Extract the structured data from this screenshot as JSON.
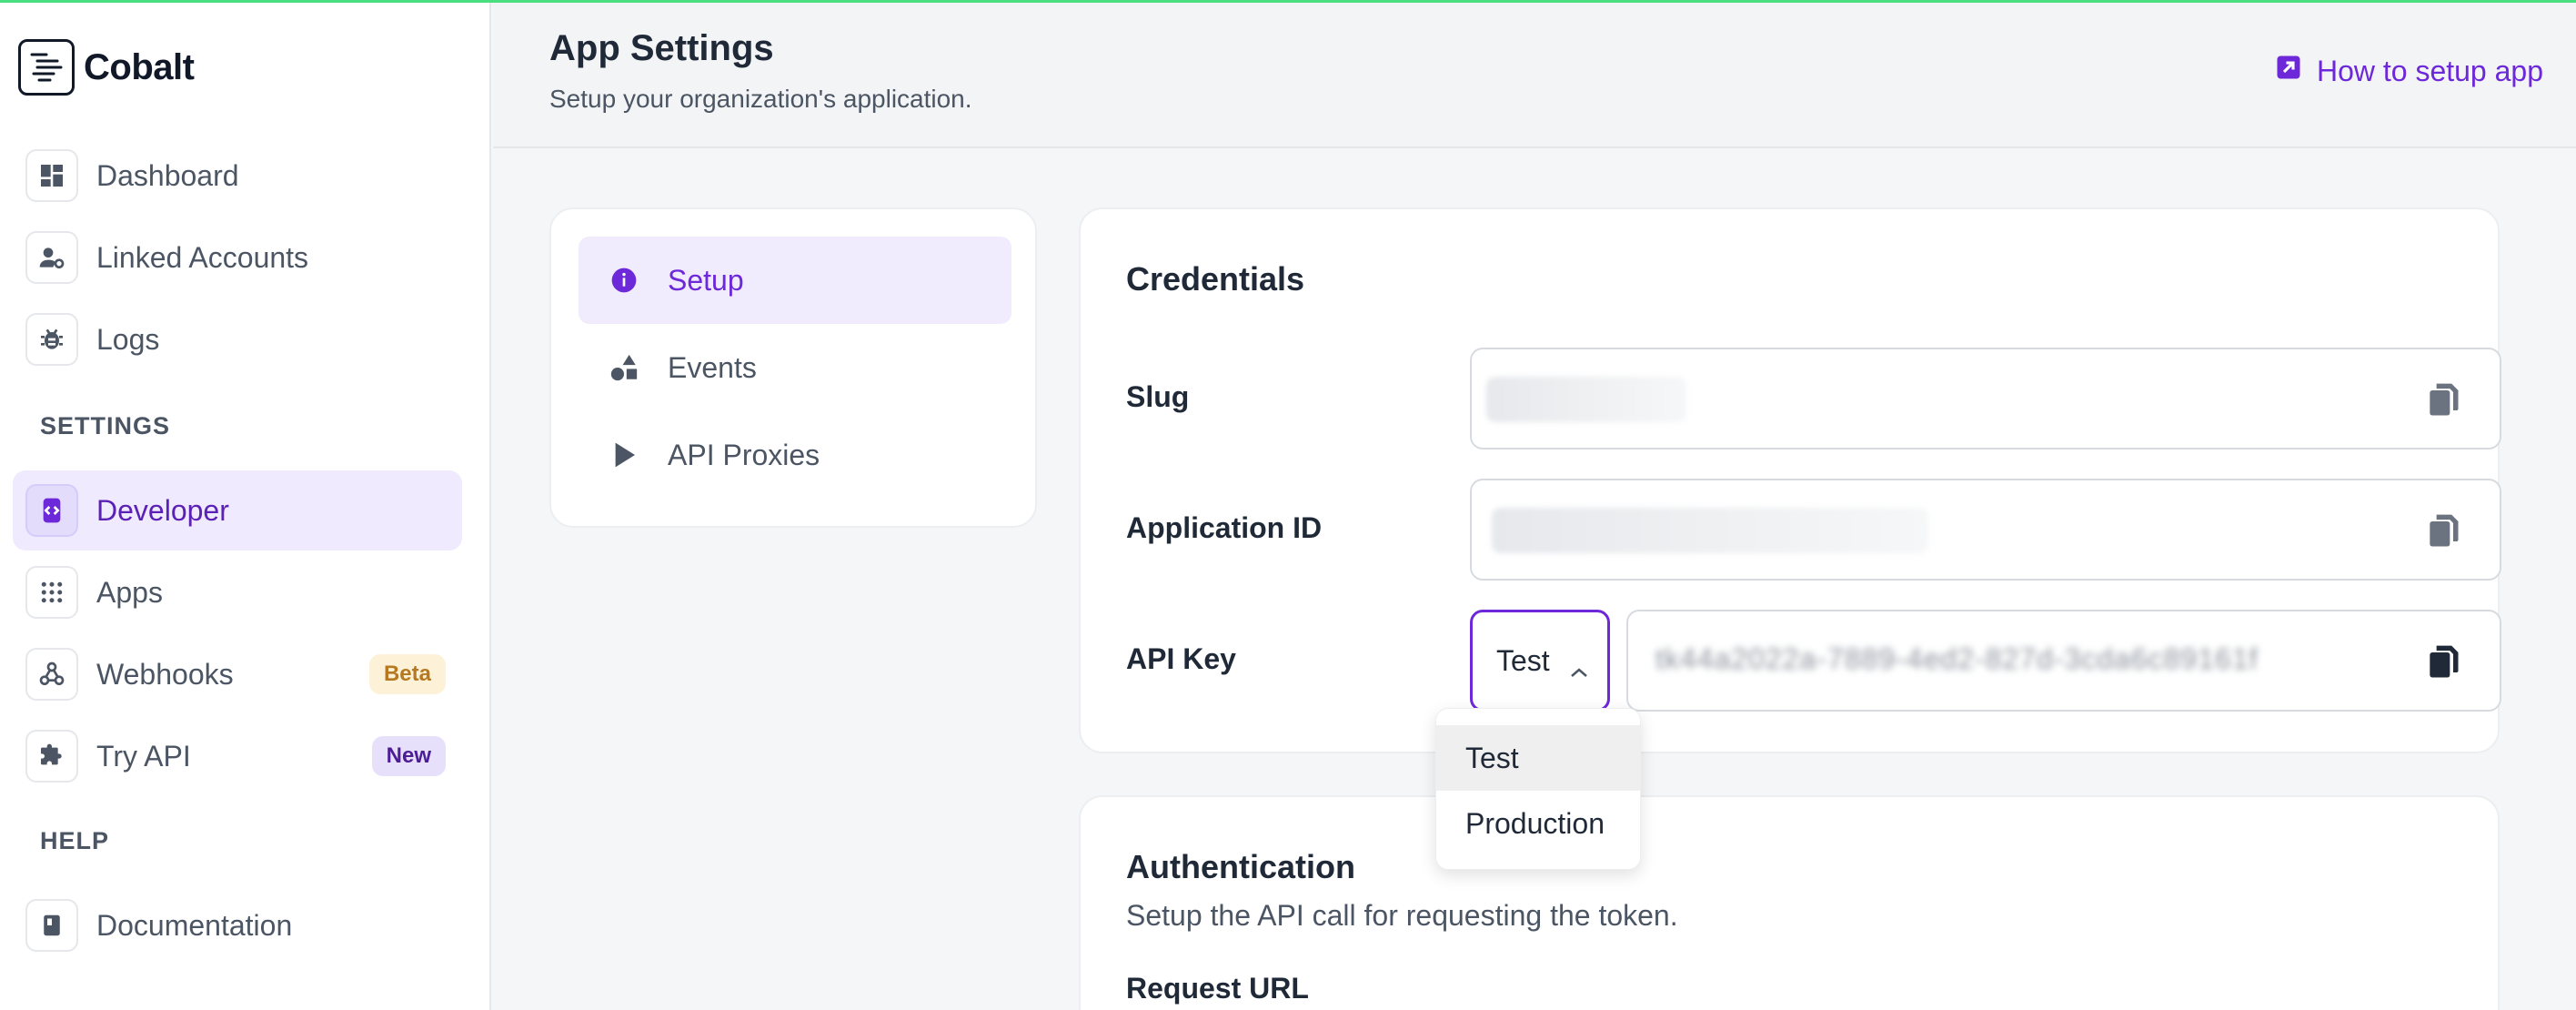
{
  "brand": {
    "name": "Cobalt"
  },
  "sidebar": {
    "items": [
      {
        "label": "Dashboard",
        "icon": "dashboard-icon"
      },
      {
        "label": "Linked Accounts",
        "icon": "user-gear-icon"
      },
      {
        "label": "Logs",
        "icon": "bug-icon"
      }
    ],
    "settings_label": "SETTINGS",
    "settings_items": [
      {
        "label": "Developer",
        "icon": "code-icon",
        "active": true
      },
      {
        "label": "Apps",
        "icon": "grid-icon"
      },
      {
        "label": "Webhooks",
        "icon": "webhook-icon",
        "badge": "Beta"
      },
      {
        "label": "Try API",
        "icon": "puzzle-icon",
        "badge": "New"
      }
    ],
    "help_label": "HELP",
    "help_items": [
      {
        "label": "Documentation",
        "icon": "book-icon"
      }
    ]
  },
  "header": {
    "title": "App Settings",
    "subtitle": "Setup your organization's application.",
    "help_link": "How to setup app"
  },
  "subnav": {
    "items": [
      {
        "label": "Setup",
        "icon": "info-icon",
        "active": true
      },
      {
        "label": "Events",
        "icon": "shapes-icon"
      },
      {
        "label": "API Proxies",
        "icon": "play-icon"
      }
    ]
  },
  "credentials": {
    "title": "Credentials",
    "slug_label": "Slug",
    "app_id_label": "Application ID",
    "api_key_label": "API Key",
    "api_key_env": "Test",
    "api_key_value": "tk44a2022a-7889-4ed2-827d-3cda6c89161f",
    "env_options": [
      "Test",
      "Production"
    ]
  },
  "authentication": {
    "title": "Authentication",
    "subtitle": "Setup the API call for requesting the token.",
    "request_url_label": "Request URL"
  },
  "colors": {
    "accent": "#6d28d9",
    "active_bg": "#efeafd",
    "beta_badge": "#fdf2d8",
    "new_badge": "#e7e0fb"
  }
}
